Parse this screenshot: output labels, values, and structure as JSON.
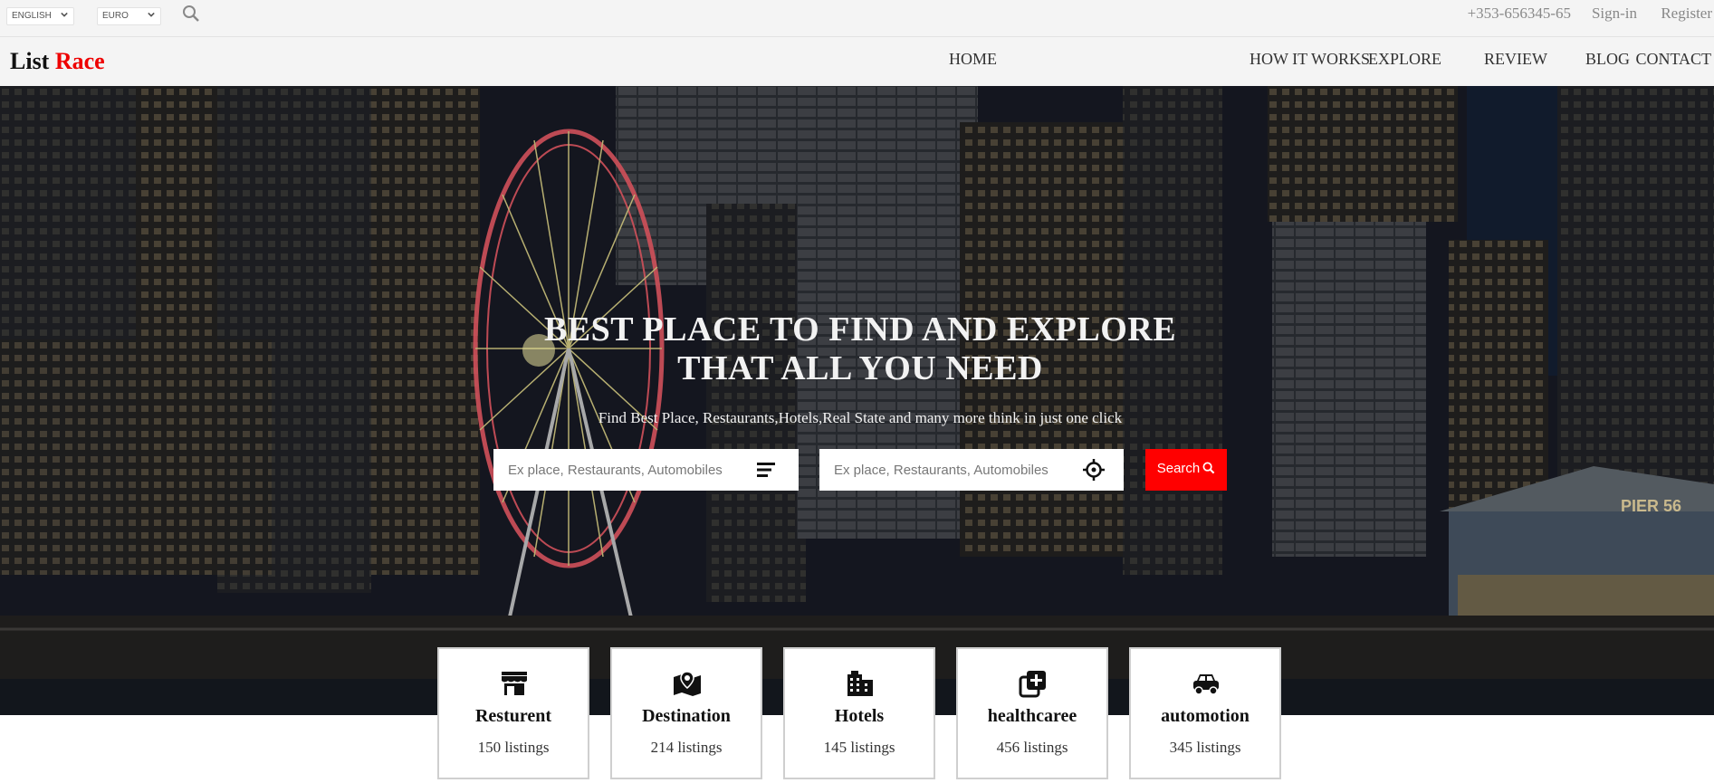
{
  "topbar": {
    "language": "ENGLISH",
    "currency": "EURO",
    "phone": "+353-656345-65",
    "signin": "Sign-in",
    "register": "Register"
  },
  "logo": {
    "part1": "List",
    "part2": "Race"
  },
  "nav": [
    "HOME",
    "HOW IT WORKS",
    "EXPLORE",
    "REVIEW",
    "BLOG",
    "CONTACT"
  ],
  "hero": {
    "title_line1": "BEST PLACE TO FIND AND EXPLORE",
    "title_line2": "THAT ALL YOU NEED",
    "subtitle": "Find Best Place, Restaurants,Hotels,Real State and many more think in just one click",
    "search1_placeholder": "Ex place, Restaurants, Automobiles",
    "search2_placeholder": "Ex place, Restaurants, Automobiles",
    "search_button": "Search"
  },
  "categories": [
    {
      "name": "Resturent",
      "count": "150 listings",
      "icon": "store-icon"
    },
    {
      "name": "Destination",
      "count": "214 listings",
      "icon": "map-pin-icon"
    },
    {
      "name": "Hotels",
      "count": "145 listings",
      "icon": "building-icon"
    },
    {
      "name": "healthcaree",
      "count": "456 listings",
      "icon": "medical-plus-icon"
    },
    {
      "name": "automotion",
      "count": "345 listings",
      "icon": "car-icon"
    }
  ],
  "colors": {
    "accent": "#ff0000",
    "logo_accent": "#ee0000",
    "bar_bg": "#f4f4f4"
  }
}
